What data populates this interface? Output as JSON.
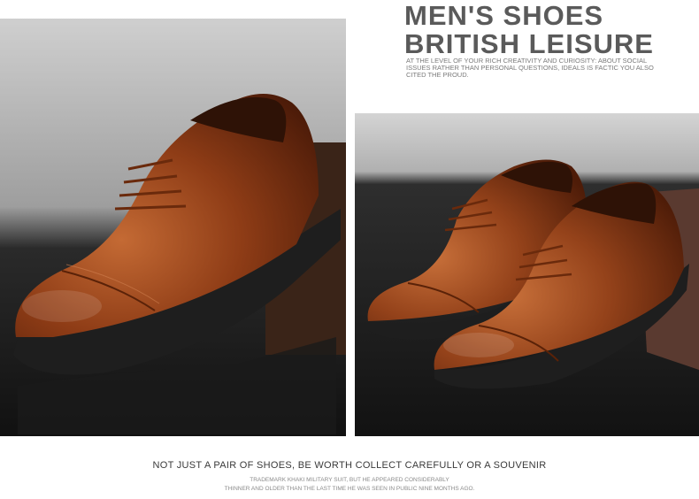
{
  "headline": {
    "line1": "MEN'S SHOES",
    "line2": "BRITISH LEISURE"
  },
  "intro_text": "AT THE LEVEL OF YOUR RICH CREATIVITY AND CURIOSITY: ABOUT SOCIAL ISSUES RATHER THAN PERSONAL QUESTIONS, IDEALS IS FACTIC YOU ALSO CITED THE PROUD.",
  "footer": {
    "title": "NOT JUST A PAIR OF SHOES, BE WORTH COLLECT CAREFULLY OR A SOUVENIR",
    "sub1": "TRADEMARK KHAKI MILITARY SUIT, BUT HE APPEARED CONSIDERABLY",
    "sub2": "THINNER AND OLDER THAN THE LAST TIME HE WAS SEEN IN PUBLIC NINE MONTHS AGO."
  },
  "colors": {
    "leather": "#8a3a14",
    "leather_light": "#b85a28",
    "sole": "#1e1e1e",
    "background_dark": "#2a2a2a",
    "heading_gray": "#5a5a5a"
  },
  "images": {
    "left": "single-brown-oxford-shoe-icon",
    "right": "pair-brown-oxford-shoes-icon"
  }
}
